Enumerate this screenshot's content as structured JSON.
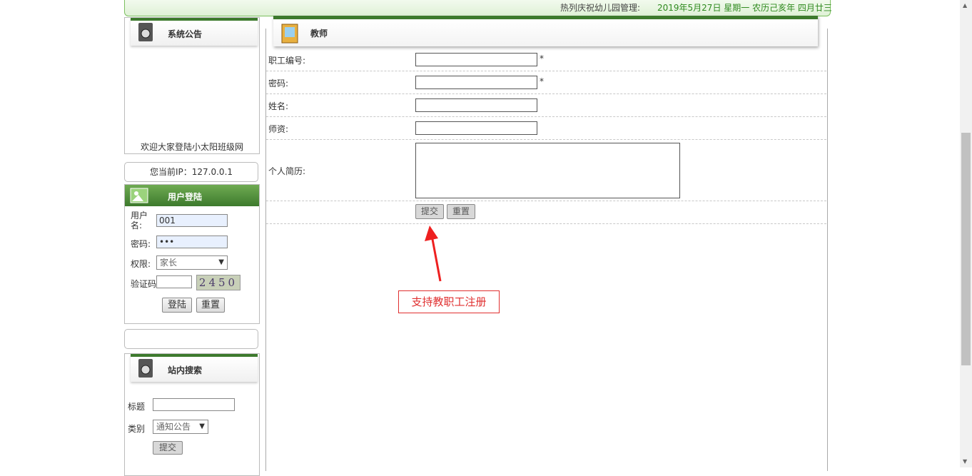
{
  "topbar": {
    "welcome": "热列庆祝幼儿园管理:",
    "date": "2019年5月27日 星期一 农历己亥年 四月廿三"
  },
  "notice": {
    "title": "系统公告",
    "welcome": "欢迎大家登陆小太阳班级网"
  },
  "ip": {
    "text": "您当前IP：127.0.0.1"
  },
  "login": {
    "title": "用户登陆",
    "username_label": "用户名:",
    "username_value": "001",
    "password_label": "密码:",
    "password_value": "•••",
    "role_label": "权限:",
    "role_value": "家长",
    "captcha_label": "验证码",
    "captcha_value": "2450",
    "login_button": "登陆",
    "reset_button": "重置"
  },
  "search": {
    "title": "站内搜索",
    "title_label": "标题",
    "category_label": "类别",
    "category_value": "通知公告",
    "submit_button": "提交"
  },
  "form": {
    "title": "教师",
    "fields": [
      {
        "label": "职工编号:",
        "required": "*"
      },
      {
        "label": "密码:",
        "required": "*"
      },
      {
        "label": "姓名:"
      },
      {
        "label": "师资:"
      },
      {
        "label": "个人简历:"
      }
    ],
    "submit_button": "提交",
    "reset_button": "重置"
  },
  "annotation": {
    "text": "支持教职工注册",
    "color": "#e03030"
  }
}
